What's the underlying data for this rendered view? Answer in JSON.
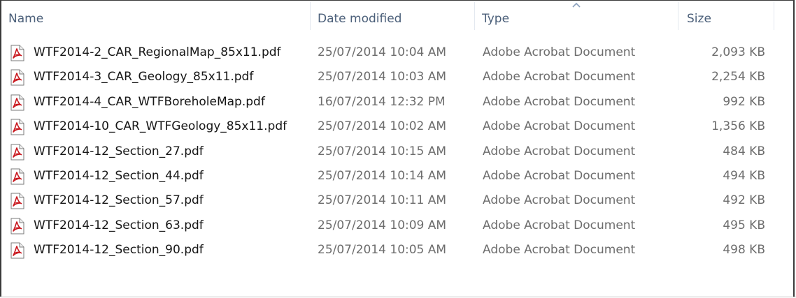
{
  "columns": {
    "name": "Name",
    "date": "Date modified",
    "type": "Type",
    "size": "Size"
  },
  "sort": {
    "column": "type",
    "direction": "ascending",
    "icon": "sort-up-arrow-icon"
  },
  "file_icon": "pdf-file-icon",
  "colors": {
    "header_text": "#4c607a",
    "pdf_red": "#c8161d",
    "secondary_text": "#6d6d6d"
  },
  "files": [
    {
      "name": "WTF2014-2_CAR_RegionalMap_85x11.pdf",
      "date": "25/07/2014 10:04 AM",
      "type": "Adobe Acrobat Document",
      "size": "2,093 KB"
    },
    {
      "name": "WTF2014-3_CAR_Geology_85x11.pdf",
      "date": "25/07/2014 10:03 AM",
      "type": "Adobe Acrobat Document",
      "size": "2,254 KB"
    },
    {
      "name": "WTF2014-4_CAR_WTFBoreholeMap.pdf",
      "date": "16/07/2014 12:32 PM",
      "type": "Adobe Acrobat Document",
      "size": "992 KB"
    },
    {
      "name": "WTF2014-10_CAR_WTFGeology_85x11.pdf",
      "date": "25/07/2014 10:02 AM",
      "type": "Adobe Acrobat Document",
      "size": "1,356 KB"
    },
    {
      "name": "WTF2014-12_Section_27.pdf",
      "date": "25/07/2014 10:15 AM",
      "type": "Adobe Acrobat Document",
      "size": "484 KB"
    },
    {
      "name": "WTF2014-12_Section_44.pdf",
      "date": "25/07/2014 10:14 AM",
      "type": "Adobe Acrobat Document",
      "size": "494 KB"
    },
    {
      "name": "WTF2014-12_Section_57.pdf",
      "date": "25/07/2014 10:11 AM",
      "type": "Adobe Acrobat Document",
      "size": "492 KB"
    },
    {
      "name": "WTF2014-12_Section_63.pdf",
      "date": "25/07/2014 10:09 AM",
      "type": "Adobe Acrobat Document",
      "size": "495 KB"
    },
    {
      "name": "WTF2014-12_Section_90.pdf",
      "date": "25/07/2014 10:05 AM",
      "type": "Adobe Acrobat Document",
      "size": "498 KB"
    }
  ]
}
